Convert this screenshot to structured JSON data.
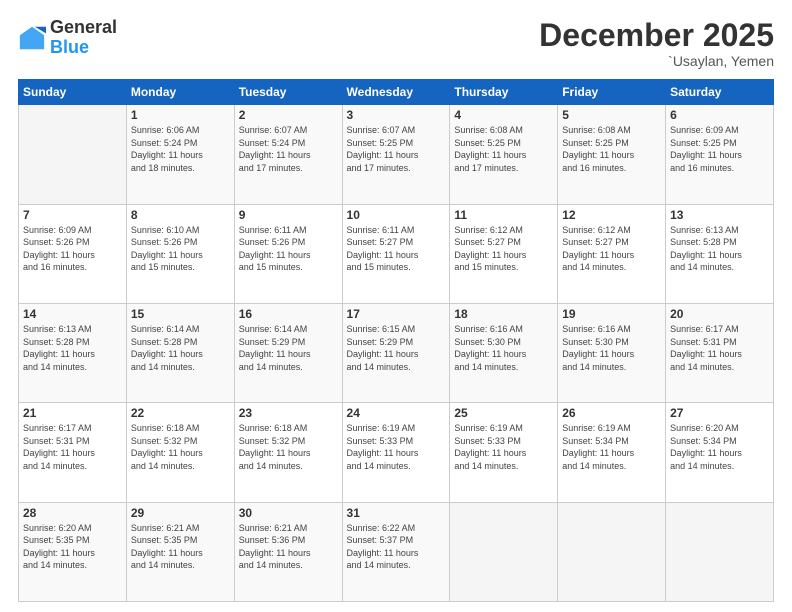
{
  "logo": {
    "general": "General",
    "blue": "Blue"
  },
  "header": {
    "month": "December 2025",
    "location": "`Usaylan, Yemen"
  },
  "days_header": [
    "Sunday",
    "Monday",
    "Tuesday",
    "Wednesday",
    "Thursday",
    "Friday",
    "Saturday"
  ],
  "weeks": [
    [
      {
        "day": "",
        "info": ""
      },
      {
        "day": "1",
        "info": "Sunrise: 6:06 AM\nSunset: 5:24 PM\nDaylight: 11 hours\nand 18 minutes."
      },
      {
        "day": "2",
        "info": "Sunrise: 6:07 AM\nSunset: 5:24 PM\nDaylight: 11 hours\nand 17 minutes."
      },
      {
        "day": "3",
        "info": "Sunrise: 6:07 AM\nSunset: 5:25 PM\nDaylight: 11 hours\nand 17 minutes."
      },
      {
        "day": "4",
        "info": "Sunrise: 6:08 AM\nSunset: 5:25 PM\nDaylight: 11 hours\nand 17 minutes."
      },
      {
        "day": "5",
        "info": "Sunrise: 6:08 AM\nSunset: 5:25 PM\nDaylight: 11 hours\nand 16 minutes."
      },
      {
        "day": "6",
        "info": "Sunrise: 6:09 AM\nSunset: 5:25 PM\nDaylight: 11 hours\nand 16 minutes."
      }
    ],
    [
      {
        "day": "7",
        "info": "Sunrise: 6:09 AM\nSunset: 5:26 PM\nDaylight: 11 hours\nand 16 minutes."
      },
      {
        "day": "8",
        "info": "Sunrise: 6:10 AM\nSunset: 5:26 PM\nDaylight: 11 hours\nand 15 minutes."
      },
      {
        "day": "9",
        "info": "Sunrise: 6:11 AM\nSunset: 5:26 PM\nDaylight: 11 hours\nand 15 minutes."
      },
      {
        "day": "10",
        "info": "Sunrise: 6:11 AM\nSunset: 5:27 PM\nDaylight: 11 hours\nand 15 minutes."
      },
      {
        "day": "11",
        "info": "Sunrise: 6:12 AM\nSunset: 5:27 PM\nDaylight: 11 hours\nand 15 minutes."
      },
      {
        "day": "12",
        "info": "Sunrise: 6:12 AM\nSunset: 5:27 PM\nDaylight: 11 hours\nand 14 minutes."
      },
      {
        "day": "13",
        "info": "Sunrise: 6:13 AM\nSunset: 5:28 PM\nDaylight: 11 hours\nand 14 minutes."
      }
    ],
    [
      {
        "day": "14",
        "info": "Sunrise: 6:13 AM\nSunset: 5:28 PM\nDaylight: 11 hours\nand 14 minutes."
      },
      {
        "day": "15",
        "info": "Sunrise: 6:14 AM\nSunset: 5:28 PM\nDaylight: 11 hours\nand 14 minutes."
      },
      {
        "day": "16",
        "info": "Sunrise: 6:14 AM\nSunset: 5:29 PM\nDaylight: 11 hours\nand 14 minutes."
      },
      {
        "day": "17",
        "info": "Sunrise: 6:15 AM\nSunset: 5:29 PM\nDaylight: 11 hours\nand 14 minutes."
      },
      {
        "day": "18",
        "info": "Sunrise: 6:16 AM\nSunset: 5:30 PM\nDaylight: 11 hours\nand 14 minutes."
      },
      {
        "day": "19",
        "info": "Sunrise: 6:16 AM\nSunset: 5:30 PM\nDaylight: 11 hours\nand 14 minutes."
      },
      {
        "day": "20",
        "info": "Sunrise: 6:17 AM\nSunset: 5:31 PM\nDaylight: 11 hours\nand 14 minutes."
      }
    ],
    [
      {
        "day": "21",
        "info": "Sunrise: 6:17 AM\nSunset: 5:31 PM\nDaylight: 11 hours\nand 14 minutes."
      },
      {
        "day": "22",
        "info": "Sunrise: 6:18 AM\nSunset: 5:32 PM\nDaylight: 11 hours\nand 14 minutes."
      },
      {
        "day": "23",
        "info": "Sunrise: 6:18 AM\nSunset: 5:32 PM\nDaylight: 11 hours\nand 14 minutes."
      },
      {
        "day": "24",
        "info": "Sunrise: 6:19 AM\nSunset: 5:33 PM\nDaylight: 11 hours\nand 14 minutes."
      },
      {
        "day": "25",
        "info": "Sunrise: 6:19 AM\nSunset: 5:33 PM\nDaylight: 11 hours\nand 14 minutes."
      },
      {
        "day": "26",
        "info": "Sunrise: 6:19 AM\nSunset: 5:34 PM\nDaylight: 11 hours\nand 14 minutes."
      },
      {
        "day": "27",
        "info": "Sunrise: 6:20 AM\nSunset: 5:34 PM\nDaylight: 11 hours\nand 14 minutes."
      }
    ],
    [
      {
        "day": "28",
        "info": "Sunrise: 6:20 AM\nSunset: 5:35 PM\nDaylight: 11 hours\nand 14 minutes."
      },
      {
        "day": "29",
        "info": "Sunrise: 6:21 AM\nSunset: 5:35 PM\nDaylight: 11 hours\nand 14 minutes."
      },
      {
        "day": "30",
        "info": "Sunrise: 6:21 AM\nSunset: 5:36 PM\nDaylight: 11 hours\nand 14 minutes."
      },
      {
        "day": "31",
        "info": "Sunrise: 6:22 AM\nSunset: 5:37 PM\nDaylight: 11 hours\nand 14 minutes."
      },
      {
        "day": "",
        "info": ""
      },
      {
        "day": "",
        "info": ""
      },
      {
        "day": "",
        "info": ""
      }
    ]
  ]
}
